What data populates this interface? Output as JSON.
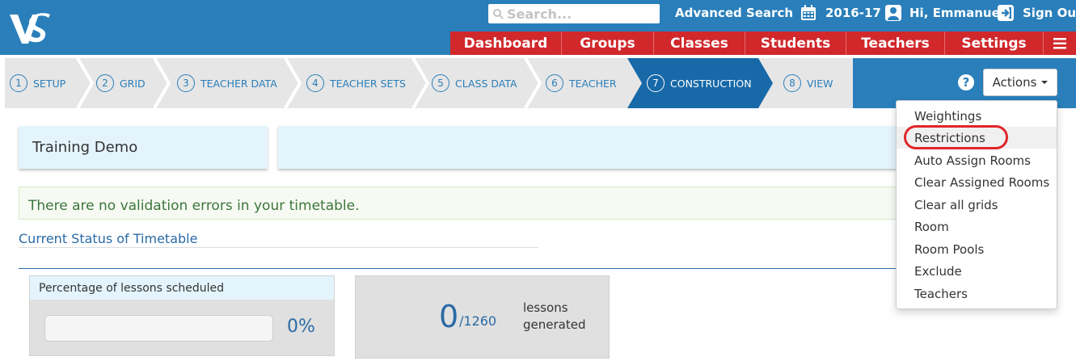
{
  "header": {
    "search_placeholder": "Search...",
    "advanced_search": "Advanced Search",
    "year": "2016-17",
    "greeting": "Hi, Emmanuel",
    "sign_out": "Sign Out"
  },
  "nav": [
    "Dashboard",
    "Groups",
    "Classes",
    "Students",
    "Teachers",
    "Settings"
  ],
  "wizard": {
    "steps": [
      {
        "num": "1",
        "label": "SETUP"
      },
      {
        "num": "2",
        "label": "GRID"
      },
      {
        "num": "3",
        "label": "TEACHER DATA"
      },
      {
        "num": "4",
        "label": "TEACHER SETS"
      },
      {
        "num": "5",
        "label": "CLASS DATA"
      },
      {
        "num": "6",
        "label": "TEACHER"
      },
      {
        "num": "7",
        "label": "CONSTRUCTION"
      },
      {
        "num": "8",
        "label": "VIEW"
      }
    ],
    "help": "?",
    "actions_label": "Actions"
  },
  "actions_menu": [
    "Weightings",
    "Restrictions",
    "Auto Assign Rooms",
    "Clear Assigned Rooms",
    "Clear all grids",
    "Room",
    "Room Pools",
    "Exclude",
    "Teachers"
  ],
  "main": {
    "timetable_name": "Training Demo",
    "validation_msg": "There are no validation errors in your timetable.",
    "status_heading": "Current Status of Timetable",
    "pct_heading": "Percentage of lessons scheduled",
    "pct_value": "0%",
    "pct_fraction": 0,
    "generated_count": "0",
    "generated_total": "/1260",
    "generated_label_1": "lessons",
    "generated_label_2": "generated"
  },
  "colors": {
    "brand": "#2a7fba",
    "nav_red": "#d0282b",
    "highlight_ring": "#e0262b"
  }
}
